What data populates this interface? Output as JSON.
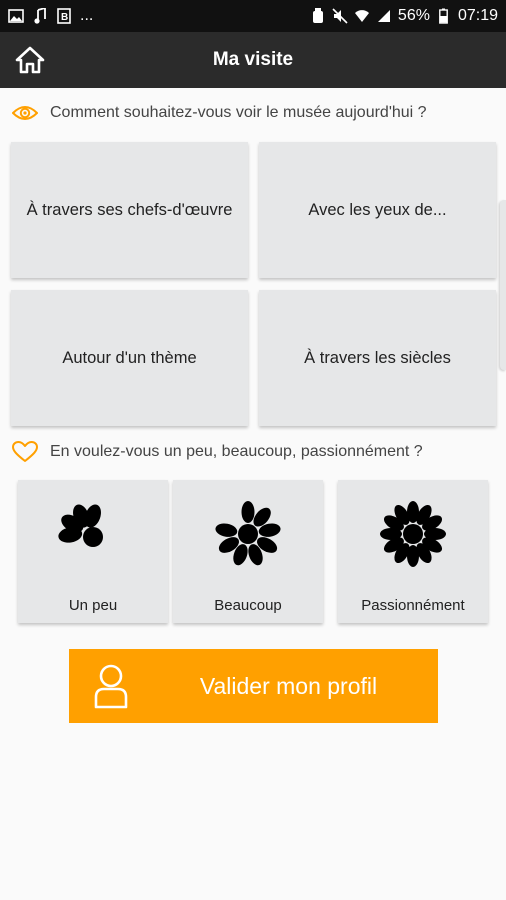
{
  "status_bar": {
    "icons_left": [
      "image-icon",
      "music-note-icon",
      "b-icon"
    ],
    "more_text": "...",
    "icons_right": [
      "alarm-icon",
      "mute-icon",
      "wifi-icon",
      "signal-icon"
    ],
    "battery": "56%",
    "time": "07:19"
  },
  "app_bar": {
    "title": "Ma visite",
    "home_icon": "home-icon"
  },
  "section1": {
    "icon": "eye-icon",
    "question": "Comment souhaitez-vous voir le musée aujourd'hui ?",
    "options": [
      "À travers ses chefs-d'œuvre",
      "Avec les yeux de...",
      "Autour d'un thème",
      "À travers les siècles"
    ]
  },
  "section2": {
    "icon": "heart-icon",
    "question": "En voulez-vous un peu, beaucoup, passionnément ?",
    "levels": [
      {
        "label": "Un peu",
        "icon": "daisy-few-petals-icon"
      },
      {
        "label": "Beaucoup",
        "icon": "daisy-many-petals-icon"
      },
      {
        "label": "Passionnément",
        "icon": "daisy-full-icon"
      }
    ]
  },
  "validate_button": {
    "label": "Valider mon profil",
    "icon": "user-icon"
  },
  "colors": {
    "accent": "#ffa000",
    "app_bar": "#2b2b2b",
    "tile": "#e6e7e8",
    "status_bar": "#111111"
  }
}
